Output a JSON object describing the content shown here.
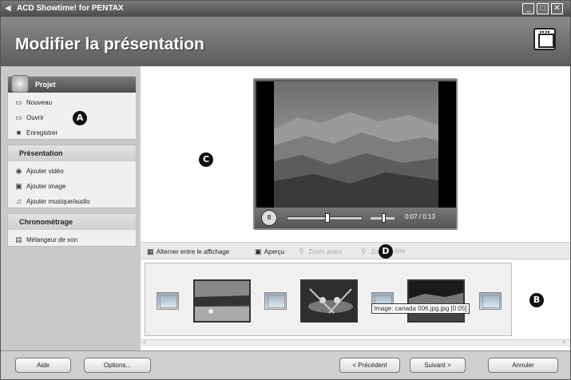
{
  "window": {
    "title": "ACD Showtime! for PENTAX",
    "minimize": "_",
    "maximize": "□",
    "close": "✕"
  },
  "header": {
    "title": "Modifier la présentation"
  },
  "sidebar": {
    "projet": {
      "title": "Projet",
      "items": [
        "Nouveau",
        "Ouvrir",
        "Enregistrer"
      ]
    },
    "presentation": {
      "title": "Présentation",
      "items": [
        "Ajouter vidéo",
        "Ajouter image",
        "Ajouter musique/audio"
      ]
    },
    "chronometrage": {
      "title": "Chronométrage",
      "items": [
        "Mélangeur de son"
      ]
    }
  },
  "callouts": {
    "a": "A",
    "b": "B",
    "c": "C",
    "d": "D"
  },
  "player": {
    "pause": "II",
    "timecode": "0:07 / 0:13",
    "progress": 0.54
  },
  "toolbar": {
    "toggle_view": "Alterner entre le affichage",
    "preview": "Aperçu",
    "zoom_in": "Zoom avant",
    "zoom_out": "Zoom arrière",
    "zoom_out_visible": "Zo"
  },
  "storyboard": {
    "tooltip": "Image: canada 006.jpg.jpg [0:05]"
  },
  "footer": {
    "help": "Aide",
    "options": "Options...",
    "previous": "< Précédent",
    "next": "Suivant >",
    "cancel": "Annuler"
  }
}
